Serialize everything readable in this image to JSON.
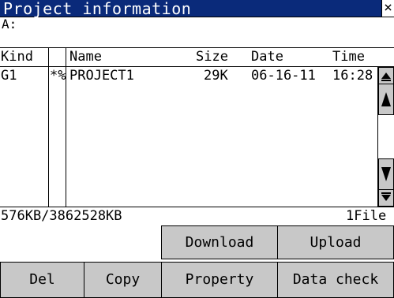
{
  "window": {
    "title": "Project information",
    "close_glyph": "×"
  },
  "drive": {
    "label": "A:"
  },
  "columns": {
    "kind": "Kind",
    "name": "Name",
    "size": "Size",
    "date": "Date",
    "time": "Time"
  },
  "files": [
    {
      "kind": "G1",
      "flags": "*%",
      "name": "PROJECT1",
      "size": "29K",
      "date": "06-16-11",
      "time": "16:28"
    }
  ],
  "status": {
    "capacity": "576KB/3862528KB",
    "file_count": "1File"
  },
  "buttons": {
    "download": "Download",
    "upload": "Upload",
    "del": "Del",
    "copy": "Copy",
    "property": "Property",
    "data_check": "Data check"
  },
  "icons": {
    "close": "close-icon",
    "scroll_top": "scroll-to-top-icon",
    "scroll_up": "scroll-up-icon",
    "scroll_down": "scroll-down-icon",
    "scroll_bottom": "scroll-to-bottom-icon"
  },
  "colors": {
    "title_bar": "#0a2a7a",
    "button_face": "#c8c8c8",
    "background": "#ffffff"
  }
}
